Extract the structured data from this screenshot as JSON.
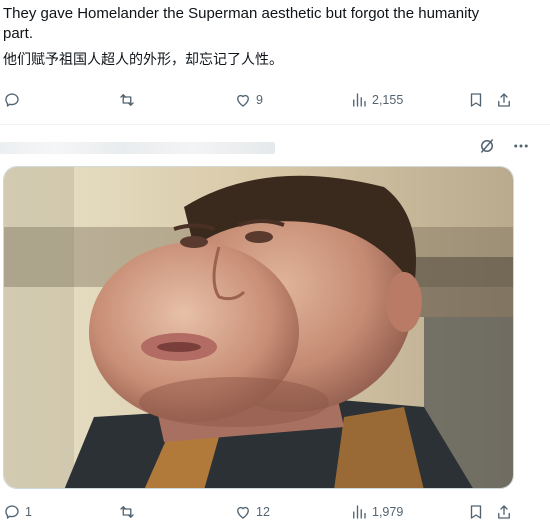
{
  "post": {
    "text": "They gave Homelander the Superman aesthetic but forgot the humanity part.",
    "translation": "他们赋予祖国人超人的外形，却忘记了人性。"
  },
  "top_actions": {
    "reply_count": "",
    "repost_count": "",
    "like_count": "9",
    "view_count": "2,155"
  },
  "second_post": {
    "media_alt": "",
    "actions": {
      "reply_count": "1",
      "repost_count": "",
      "like_count": "12",
      "view_count": "1,979"
    }
  },
  "icons": [
    "reply-icon",
    "repost-icon",
    "like-icon",
    "views-icon",
    "bookmark-icon",
    "share-icon",
    "grok-icon",
    "more-icon"
  ],
  "colors": {
    "icon_gray": "#536471",
    "text": "#0f1419",
    "divider": "#eff3f4"
  }
}
